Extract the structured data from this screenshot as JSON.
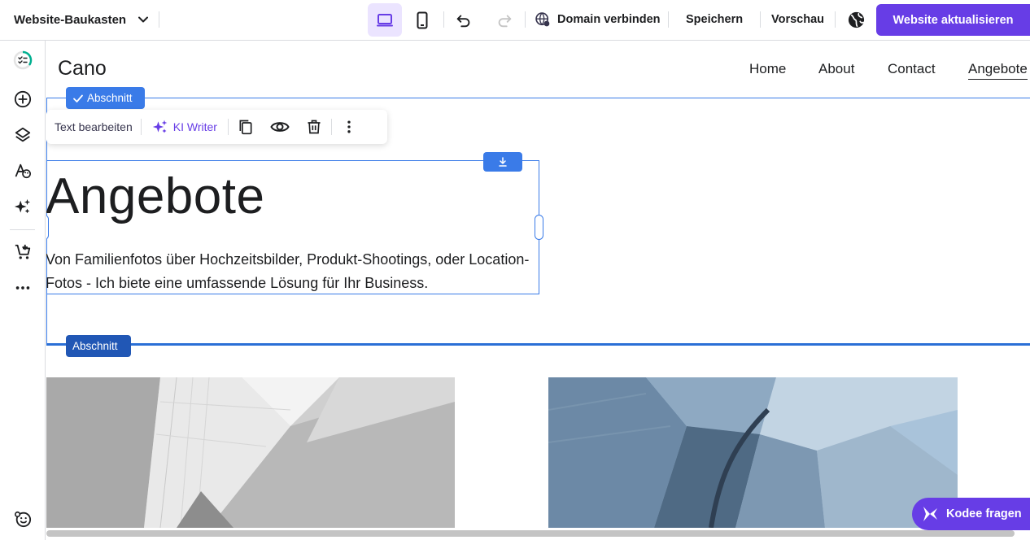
{
  "topbar": {
    "brand": "Website-Baukasten",
    "domain_label": "Domain verbinden",
    "save_label": "Speichern",
    "preview_label": "Vorschau",
    "publish_label": "Website aktualisieren"
  },
  "site": {
    "logo": "Cano",
    "nav": [
      "Home",
      "About",
      "Contact",
      "Angebote"
    ],
    "active_nav": "Angebote"
  },
  "editor": {
    "section_label": "Abschnitt",
    "section_label_2": "Abschnitt",
    "toolbar": {
      "edit_text": "Text bearbeiten",
      "ai_writer": "KI Writer"
    }
  },
  "hero": {
    "title": "Angebote",
    "text": "Von Familienfotos über Hochzeitsbilder, Produkt-Shootings, oder Location-Fotos - Ich biete eine umfassende Lösung für Ihr Business."
  },
  "assistant": {
    "label": "Kodee fragen"
  },
  "colors": {
    "brand_purple": "#673de6",
    "selection_blue": "#3a7be8"
  }
}
